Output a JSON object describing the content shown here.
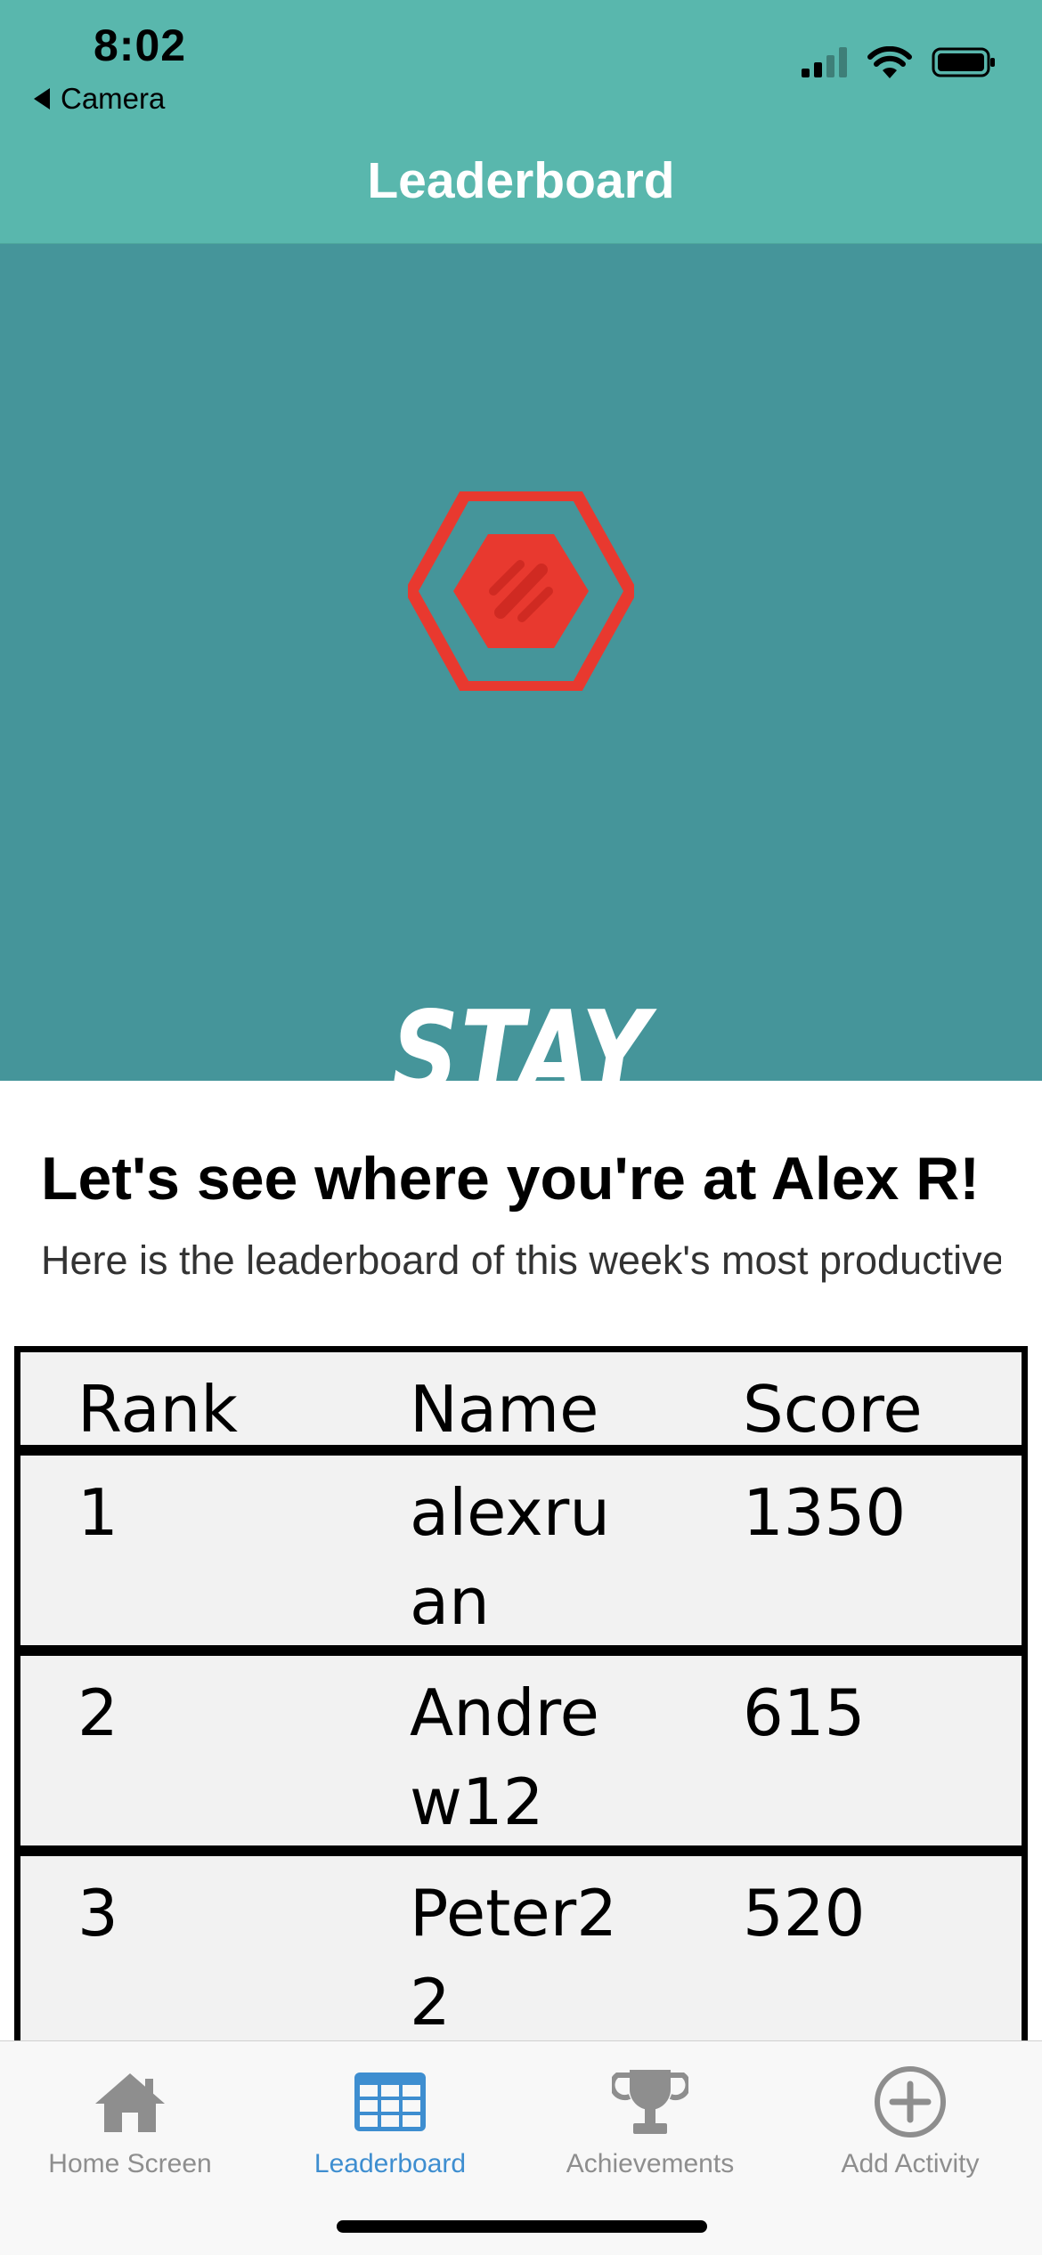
{
  "status_bar": {
    "time": "8:02",
    "back_label": "Camera",
    "icons": [
      "signal-icon",
      "wifi-icon",
      "battery-icon"
    ]
  },
  "nav": {
    "title": "Leaderboard"
  },
  "hero": {
    "logo_icon": "hexagon-logo-icon",
    "motto": "STAY MOTIVATED!",
    "colors": {
      "background": "#45959a",
      "logo": "#e8392f"
    }
  },
  "intro": {
    "heading": "Let's see where you're at Alex R!",
    "subheading": "Here is the leaderboard of this week's most productive"
  },
  "leaderboard": {
    "columns": {
      "rank": "Rank",
      "name": "Name",
      "score": "Score"
    },
    "rows": [
      {
        "rank": "1",
        "name": "alexruan",
        "score": "1350"
      },
      {
        "rank": "2",
        "name": "Andrew12",
        "score": "615"
      },
      {
        "rank": "3",
        "name": "Peter22",
        "score": "520"
      }
    ]
  },
  "tabbar": {
    "tabs": [
      {
        "label": "Home Screen",
        "icon": "home-icon"
      },
      {
        "label": "Leaderboard",
        "icon": "table-icon",
        "active": true
      },
      {
        "label": "Achievements",
        "icon": "trophy-icon"
      },
      {
        "label": "Add Activity",
        "icon": "plus-circle-icon"
      }
    ],
    "active_color": "#3e8ed0",
    "inactive_color": "#8e8e8e"
  }
}
